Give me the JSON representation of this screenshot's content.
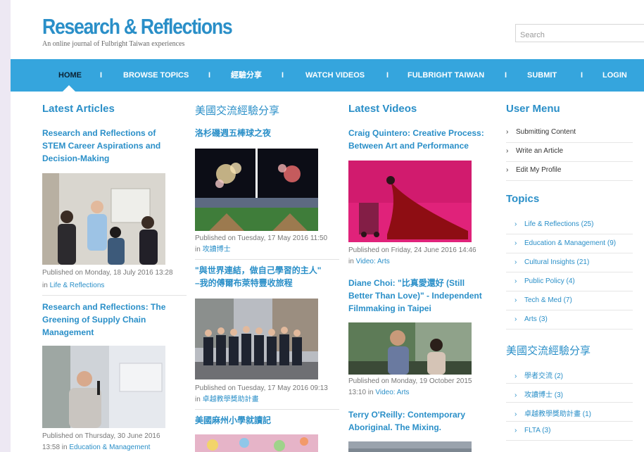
{
  "site": {
    "title": "Research & Reflections",
    "tagline": "An online journal of Fulbright Taiwan experiences",
    "search_placeholder": "Search"
  },
  "nav": {
    "items": [
      "HOME",
      "BROWSE TOPICS",
      "經驗分享",
      "WATCH VIDEOS",
      "FULBRIGHT TAIWAN",
      "SUBMIT",
      "LOGIN"
    ],
    "separator": "I",
    "active": "HOME"
  },
  "latest_articles": {
    "heading": "Latest Articles",
    "items": [
      {
        "title_lines": [
          "Research and Reflections of",
          "STEM Career Aspirations and",
          "Decision-Making"
        ],
        "published": "Published on Monday, 18 July 2016 13:28",
        "in": "in",
        "category": "Life & Reflections"
      },
      {
        "title_lines": [
          "Research and Reflections: The",
          "Greening of Supply Chain",
          "Management"
        ],
        "published_line1": "Published on Thursday, 30 June 2016",
        "published_line2": "13:58 in",
        "category": "Education & Management"
      }
    ]
  },
  "exchange": {
    "heading": "美國交流經驗分享",
    "items": [
      {
        "title_lines": [
          "洛杉磯週五棒球之夜"
        ],
        "published": "Published on Tuesday, 17 May 2016 11:50",
        "in": "in",
        "category": "攻讀博士"
      },
      {
        "title_lines": [
          "\"與世界連結，做自己學習的主人\"",
          "–我的傅爾布萊特豐收旅程"
        ],
        "published": "Published on Tuesday, 17 May 2016 09:13",
        "in": "in",
        "category": "卓越教學獎助計畫"
      },
      {
        "title_lines": [
          "美國麻州小學就讀記"
        ]
      }
    ]
  },
  "latest_videos": {
    "heading": "Latest Videos",
    "items": [
      {
        "title_lines": [
          "Craig Quintero: Creative Process:",
          "Between Art and Performance"
        ],
        "published": "Published on Friday, 24 June 2016 14:46",
        "in": "in",
        "category": "Video: Arts"
      },
      {
        "title_lines": [
          "Diane Choi: \"比真愛還好 (Still",
          "Better Than Love)\" - Independent",
          "Filmmaking in Taipei"
        ],
        "published_line1": "Published on Monday, 19 October 2015",
        "published_line2": "13:10 in",
        "category": "Video: Arts"
      },
      {
        "title_lines": [
          "Terry O'Reilly: Contemporary",
          "Aboriginal. The Mixing."
        ]
      }
    ]
  },
  "user_menu": {
    "heading": "User Menu",
    "items": [
      "Submitting Content",
      "Write an Article",
      "Edit My Profile"
    ]
  },
  "topics": {
    "heading": "Topics",
    "items": [
      {
        "label": "Life & Reflections",
        "count": "(25)"
      },
      {
        "label": "Education & Management",
        "count": "(9)"
      },
      {
        "label": "Cultural Insights",
        "count": "(21)"
      },
      {
        "label": "Public Policy",
        "count": "(4)"
      },
      {
        "label": "Tech & Med",
        "count": "(7)"
      },
      {
        "label": "Arts",
        "count": "(3)"
      }
    ]
  },
  "exchange_topics": {
    "heading": "美國交流經驗分享",
    "items": [
      {
        "label": "學者交流",
        "count": "(2)"
      },
      {
        "label": "攻讀博士",
        "count": "(3)"
      },
      {
        "label": "卓越教學獎助計畫",
        "count": "(1)"
      },
      {
        "label": "FLTA",
        "count": "(3)"
      }
    ]
  },
  "colors": {
    "brand_blue": "#2a8fc8",
    "nav_blue": "#35a5dd",
    "page_bg": "#ede8f3"
  }
}
